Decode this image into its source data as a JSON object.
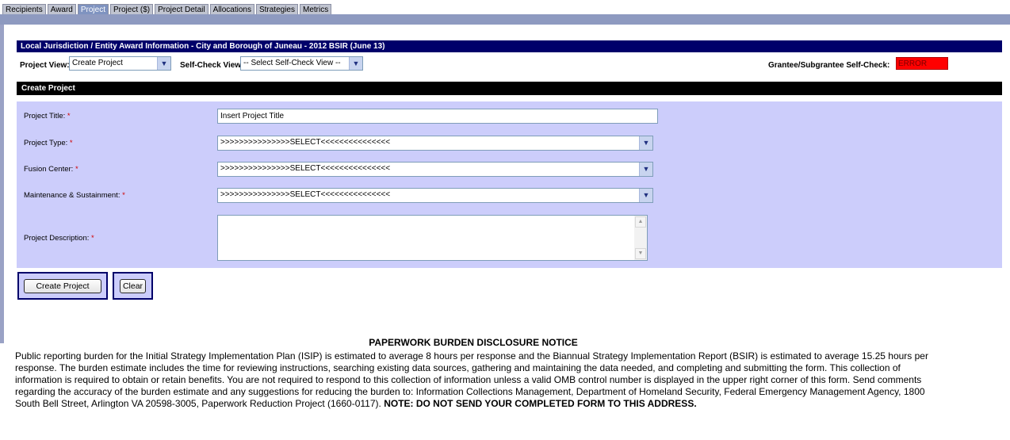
{
  "tabs": [
    {
      "label": "Recipients",
      "active": false
    },
    {
      "label": "Award",
      "active": false
    },
    {
      "label": "Project",
      "active": true
    },
    {
      "label": "Project ($)",
      "active": false
    },
    {
      "label": "Project Detail",
      "active": false
    },
    {
      "label": "Allocations",
      "active": false
    },
    {
      "label": "Strategies",
      "active": false
    },
    {
      "label": "Metrics",
      "active": false
    }
  ],
  "header": {
    "title": "Local Jurisdiction / Entity Award Information - City and Borough of Juneau - 2012 BSIR (June 13)"
  },
  "views": {
    "project_view_label": "Project View:",
    "project_view_value": "Create Project",
    "self_check_view_label": "Self-Check View:",
    "self_check_view_value": "-- Select Self-Check View --",
    "grantee_label": "Grantee/Subgrantee Self-Check:",
    "grantee_status": "ERROR"
  },
  "section": {
    "title": "Create Project"
  },
  "form": {
    "project_title_label": "Project Title:",
    "project_title_value": "Insert Project Title",
    "project_type_label": "Project Type:",
    "project_type_value": ">>>>>>>>>>>>>>>SELECT<<<<<<<<<<<<<<<",
    "fusion_center_label": "Fusion Center:",
    "fusion_center_value": ">>>>>>>>>>>>>>>SELECT<<<<<<<<<<<<<<<",
    "maintenance_label": "Maintenance & Sustainment:",
    "maintenance_value": ">>>>>>>>>>>>>>>SELECT<<<<<<<<<<<<<<<",
    "description_label": "Project Description:",
    "required_marker": "*"
  },
  "buttons": {
    "create": "Create Project",
    "clear": "Clear"
  },
  "icons": {
    "dropdown": "chevron-down-icon",
    "scroll_up": "scroll-up-icon",
    "scroll_down": "scroll-down-icon"
  },
  "colors": {
    "navy": "#00006a",
    "panel": "#cccdfb",
    "error": "#ff0000",
    "required": "#d00000"
  },
  "notice": {
    "title": "PAPERWORK BURDEN DISCLOSURE NOTICE",
    "body": "Public reporting burden for the Initial Strategy Implementation Plan (ISIP) is estimated to average 8 hours per response and the Biannual Strategy Implementation Report (BSIR) is estimated to average 15.25 hours per response. The burden estimate includes the time for reviewing instructions, searching existing data sources, gathering and maintaining the data needed, and completing and submitting the form. This collection of information is required to obtain or retain benefits. You are not required to respond to this collection of information unless a valid OMB control number is displayed in the upper right corner of this form. Send comments regarding the accuracy of the burden estimate and any suggestions for reducing the burden to: Information Collections Management, Department of Homeland Security, Federal Emergency Management Agency, 1800 South Bell Street, Arlington VA 20598-3005, Paperwork Reduction Project (1660-0117).",
    "emphasis": "NOTE: DO NOT SEND YOUR COMPLETED FORM TO THIS ADDRESS."
  }
}
